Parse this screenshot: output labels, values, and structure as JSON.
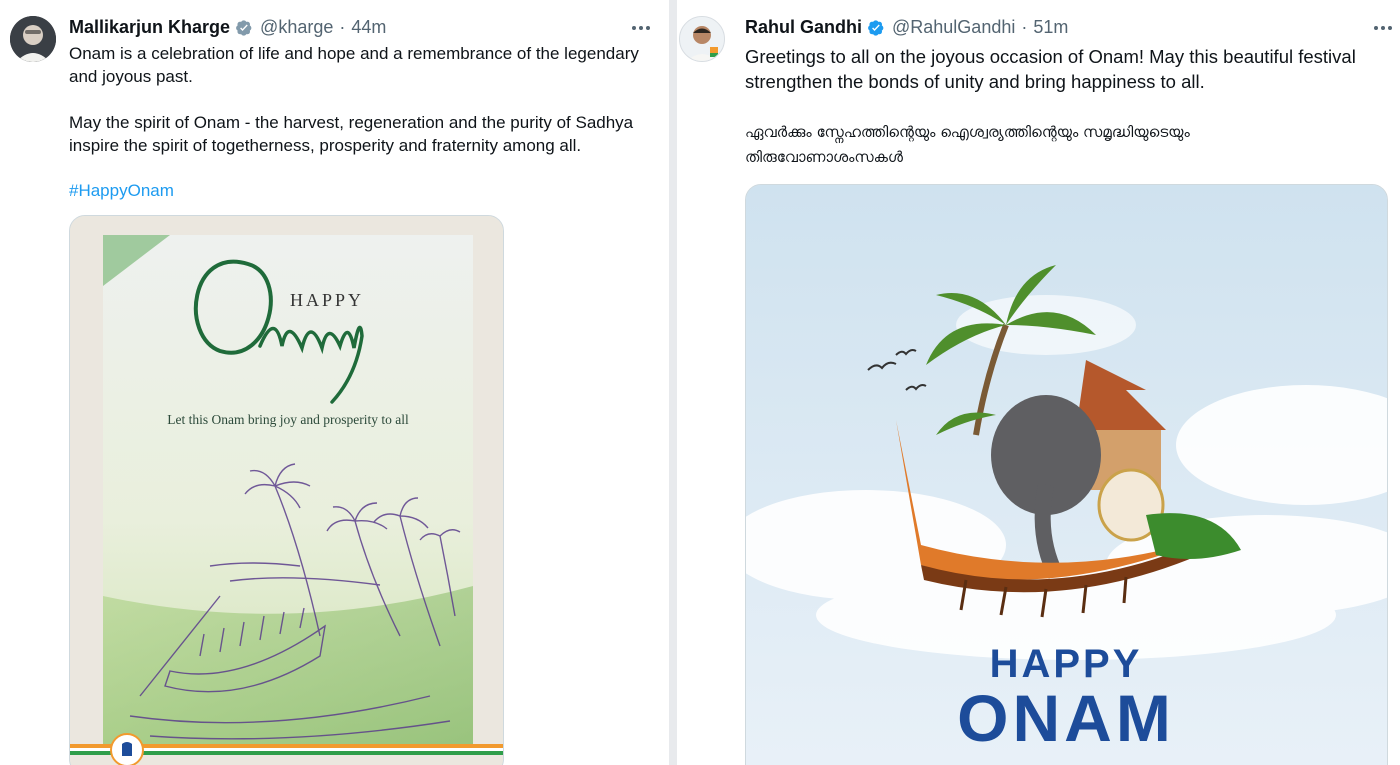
{
  "tweets": [
    {
      "author": "Mallikarjun Kharge",
      "handle": "@kharge",
      "separator": "·",
      "time": "44m",
      "paragraphs": [
        "Onam is a celebration of life and hope and a remembrance of the legendary and joyous past.",
        "May the spirit of Onam - the harvest, regeneration and the purity of Sadhya inspire the spirit of togetherness, prosperity and fraternity among all."
      ],
      "hashtag": "#HappyOnam",
      "image": {
        "heading_small": "HAPPY",
        "heading_script": "Onam",
        "caption": "Let this Onam bring joy and prosperity to all"
      }
    },
    {
      "author": "Rahul Gandhi",
      "handle": "@RahulGandhi",
      "separator": "·",
      "time": "51m",
      "paragraphs": [
        "Greetings to all on the joyous occasion of Onam! May this beautiful festival strengthen the bonds of unity and bring happiness to all.",
        "ഏവർക്കും സ്നേഹത്തിന്റെയും ഐശ്വര്യത്തിന്റെയും സമൃദ്ധിയുടെയും തിരുവോണാശംസകൾ"
      ],
      "image": {
        "line1": "HAPPY",
        "line2": "ONAM"
      }
    }
  ],
  "colors": {
    "link": "#1d9bf0",
    "verified": "#1d9bf0",
    "secondary_text": "#536471",
    "onam_green": "#1f6b3a",
    "poster_blue": "#1d4c9a"
  }
}
